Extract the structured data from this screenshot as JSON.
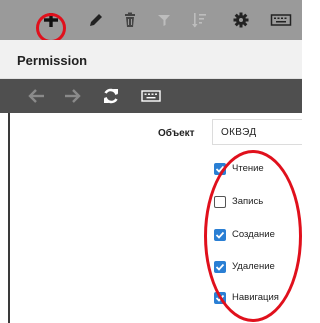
{
  "colors": {
    "toolbar_bg": "#9a9a9a",
    "nav_bg": "#4f4f4f",
    "highlight": "#e0101c",
    "checkbox_checked": "#2a7fd4"
  },
  "toolbar": {
    "buttons": [
      {
        "icon": "plus-icon"
      },
      {
        "icon": "pencil-icon"
      },
      {
        "icon": "trash-icon"
      },
      {
        "icon": "filter-icon"
      },
      {
        "icon": "sort-icon"
      },
      {
        "icon": "gear-icon"
      },
      {
        "icon": "keyboard-icon"
      }
    ]
  },
  "title": "Permission",
  "nav": {
    "buttons": [
      {
        "icon": "arrow-left-icon"
      },
      {
        "icon": "arrow-right-icon"
      },
      {
        "icon": "refresh-icon"
      },
      {
        "icon": "keyboard-icon"
      }
    ]
  },
  "form": {
    "object_label": "Объект",
    "object_value": "ОКВЭД"
  },
  "permissions": [
    {
      "label": "Чтение",
      "checked": true
    },
    {
      "label": "Запись",
      "checked": false
    },
    {
      "label": "Создание",
      "checked": true
    },
    {
      "label": "Удаление",
      "checked": true
    },
    {
      "label": "Навигация",
      "checked": true
    }
  ]
}
